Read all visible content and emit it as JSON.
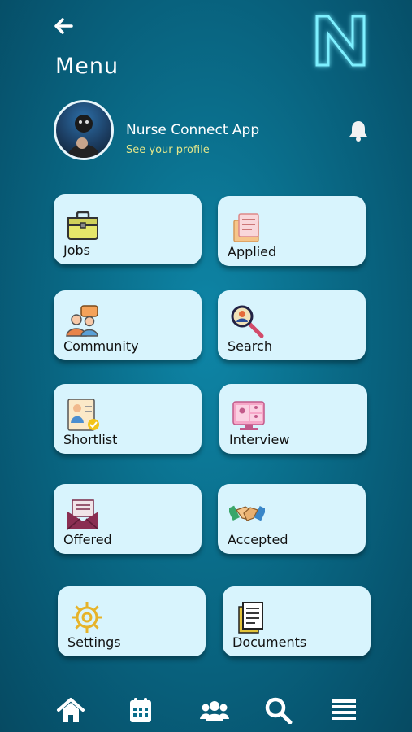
{
  "header": {
    "title": "Menu",
    "back_icon": "arrow-left-icon",
    "logo_icon": "n-logo-icon"
  },
  "profile": {
    "app_name": "Nurse Connect App",
    "link": "See your profile",
    "bell_icon": "bell-icon"
  },
  "menu": {
    "items": [
      {
        "label": "Jobs",
        "icon": "briefcase-icon"
      },
      {
        "label": "Applied",
        "icon": "applied-documents-icon"
      },
      {
        "label": "Community",
        "icon": "community-chat-icon"
      },
      {
        "label": "Search",
        "icon": "magnifier-icon"
      },
      {
        "label": "Shortlist",
        "icon": "shortlist-profile-icon"
      },
      {
        "label": "Interview",
        "icon": "video-interview-icon"
      },
      {
        "label": "Offered",
        "icon": "envelope-icon"
      },
      {
        "label": "Accepted",
        "icon": "handshake-icon"
      },
      {
        "label": "Settings",
        "icon": "gear-icon"
      },
      {
        "label": "Documents",
        "icon": "documents-icon"
      }
    ]
  },
  "bottom_nav": [
    "home-icon",
    "calendar-icon",
    "users-icon",
    "search-icon",
    "menu-icon"
  ],
  "colors": {
    "card_bg": "#d8f4fd",
    "accent_link": "#e3e68a",
    "background": "#0a6d8a"
  }
}
